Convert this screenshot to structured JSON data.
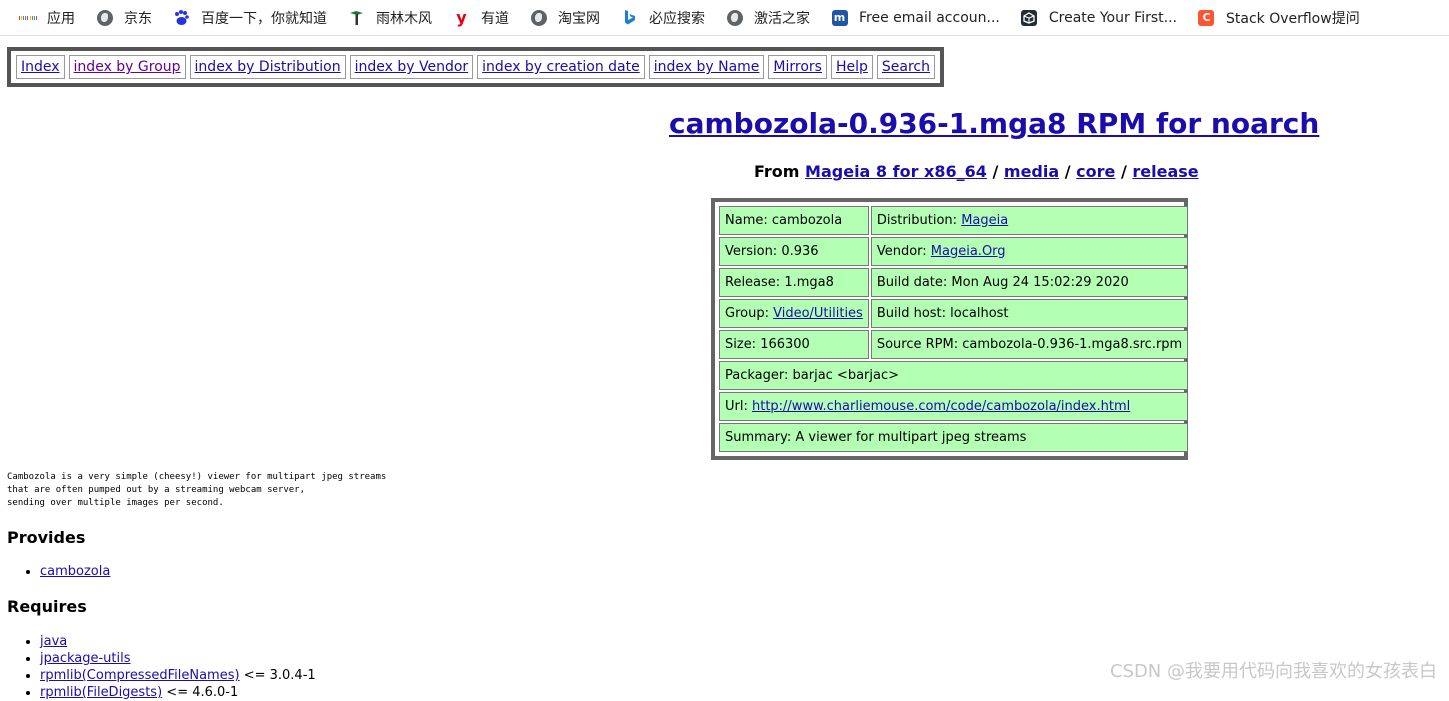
{
  "bookmarks": [
    {
      "label": "应用",
      "icon": "apps-grid-icon"
    },
    {
      "label": "京东",
      "icon": "globe-icon"
    },
    {
      "label": "百度一下，你就知道",
      "icon": "baidu-paw-icon"
    },
    {
      "label": "雨林木风",
      "icon": "ylmf-tree-icon"
    },
    {
      "label": "有道",
      "icon": "youdao-icon"
    },
    {
      "label": "淘宝网",
      "icon": "globe-icon"
    },
    {
      "label": "必应搜索",
      "icon": "bing-icon"
    },
    {
      "label": "激活之家",
      "icon": "globe-icon"
    },
    {
      "label": "Free email accoun...",
      "icon": "mail-icon"
    },
    {
      "label": "Create Your First...",
      "icon": "unity-icon"
    },
    {
      "label": "Stack Overflow提问",
      "icon": "csdn-icon"
    }
  ],
  "nav": [
    "Index",
    "index by Group",
    "index by Distribution",
    "index by Vendor",
    "index by creation date",
    "index by Name",
    "Mirrors",
    "Help",
    "Search"
  ],
  "title": "cambozola-0.936-1.mga8 RPM for noarch",
  "from": {
    "prefix": "From",
    "distro": "Mageia 8 for x86_64",
    "sep": "/",
    "media": "media",
    "core": "core",
    "release": "release"
  },
  "info": {
    "name_label": "Name: ",
    "name": "cambozola",
    "distribution_label": "Distribution: ",
    "distribution": "Mageia",
    "version_label": "Version: ",
    "version": "0.936",
    "vendor_label": "Vendor: ",
    "vendor": "Mageia.Org",
    "release_label": "Release: ",
    "release": "1.mga8",
    "build_date_label": "Build date: ",
    "build_date": "Mon Aug 24 15:02:29 2020",
    "group_label": "Group: ",
    "group": "Video/Utilities",
    "build_host_label": "Build host: ",
    "build_host": "localhost",
    "size_label": "Size: ",
    "size": "166300",
    "source_rpm_label": "Source RPM: ",
    "source_rpm": "cambozola-0.936-1.mga8.src.rpm",
    "packager_label": "Packager: ",
    "packager": "barjac <barjac>",
    "url_label": "Url: ",
    "url": "http://www.charliemouse.com/code/cambozola/index.html",
    "summary_label": "Summary: ",
    "summary": "A viewer for multipart jpeg streams"
  },
  "description": "Cambozola is a very simple (cheesy!) viewer for multipart jpeg streams\nthat are often pumped out by a streaming webcam server,\nsending over multiple images per second.",
  "provides": {
    "heading": "Provides",
    "items": [
      "cambozola"
    ]
  },
  "requires": {
    "heading": "Requires",
    "items": [
      {
        "name": "java",
        "ver": ""
      },
      {
        "name": "jpackage-utils",
        "ver": ""
      },
      {
        "name": "rpmlib(CompressedFileNames)",
        "ver": "<= 3.0.4-1"
      },
      {
        "name": "rpmlib(FileDigests)",
        "ver": "<= 4.6.0-1"
      }
    ]
  },
  "watermark": "CSDN @我要用代码向我喜欢的女孩表白",
  "colors": {
    "link": "#1a0dab",
    "visited": "#660099",
    "cell_bg": "#b3ffb3"
  }
}
